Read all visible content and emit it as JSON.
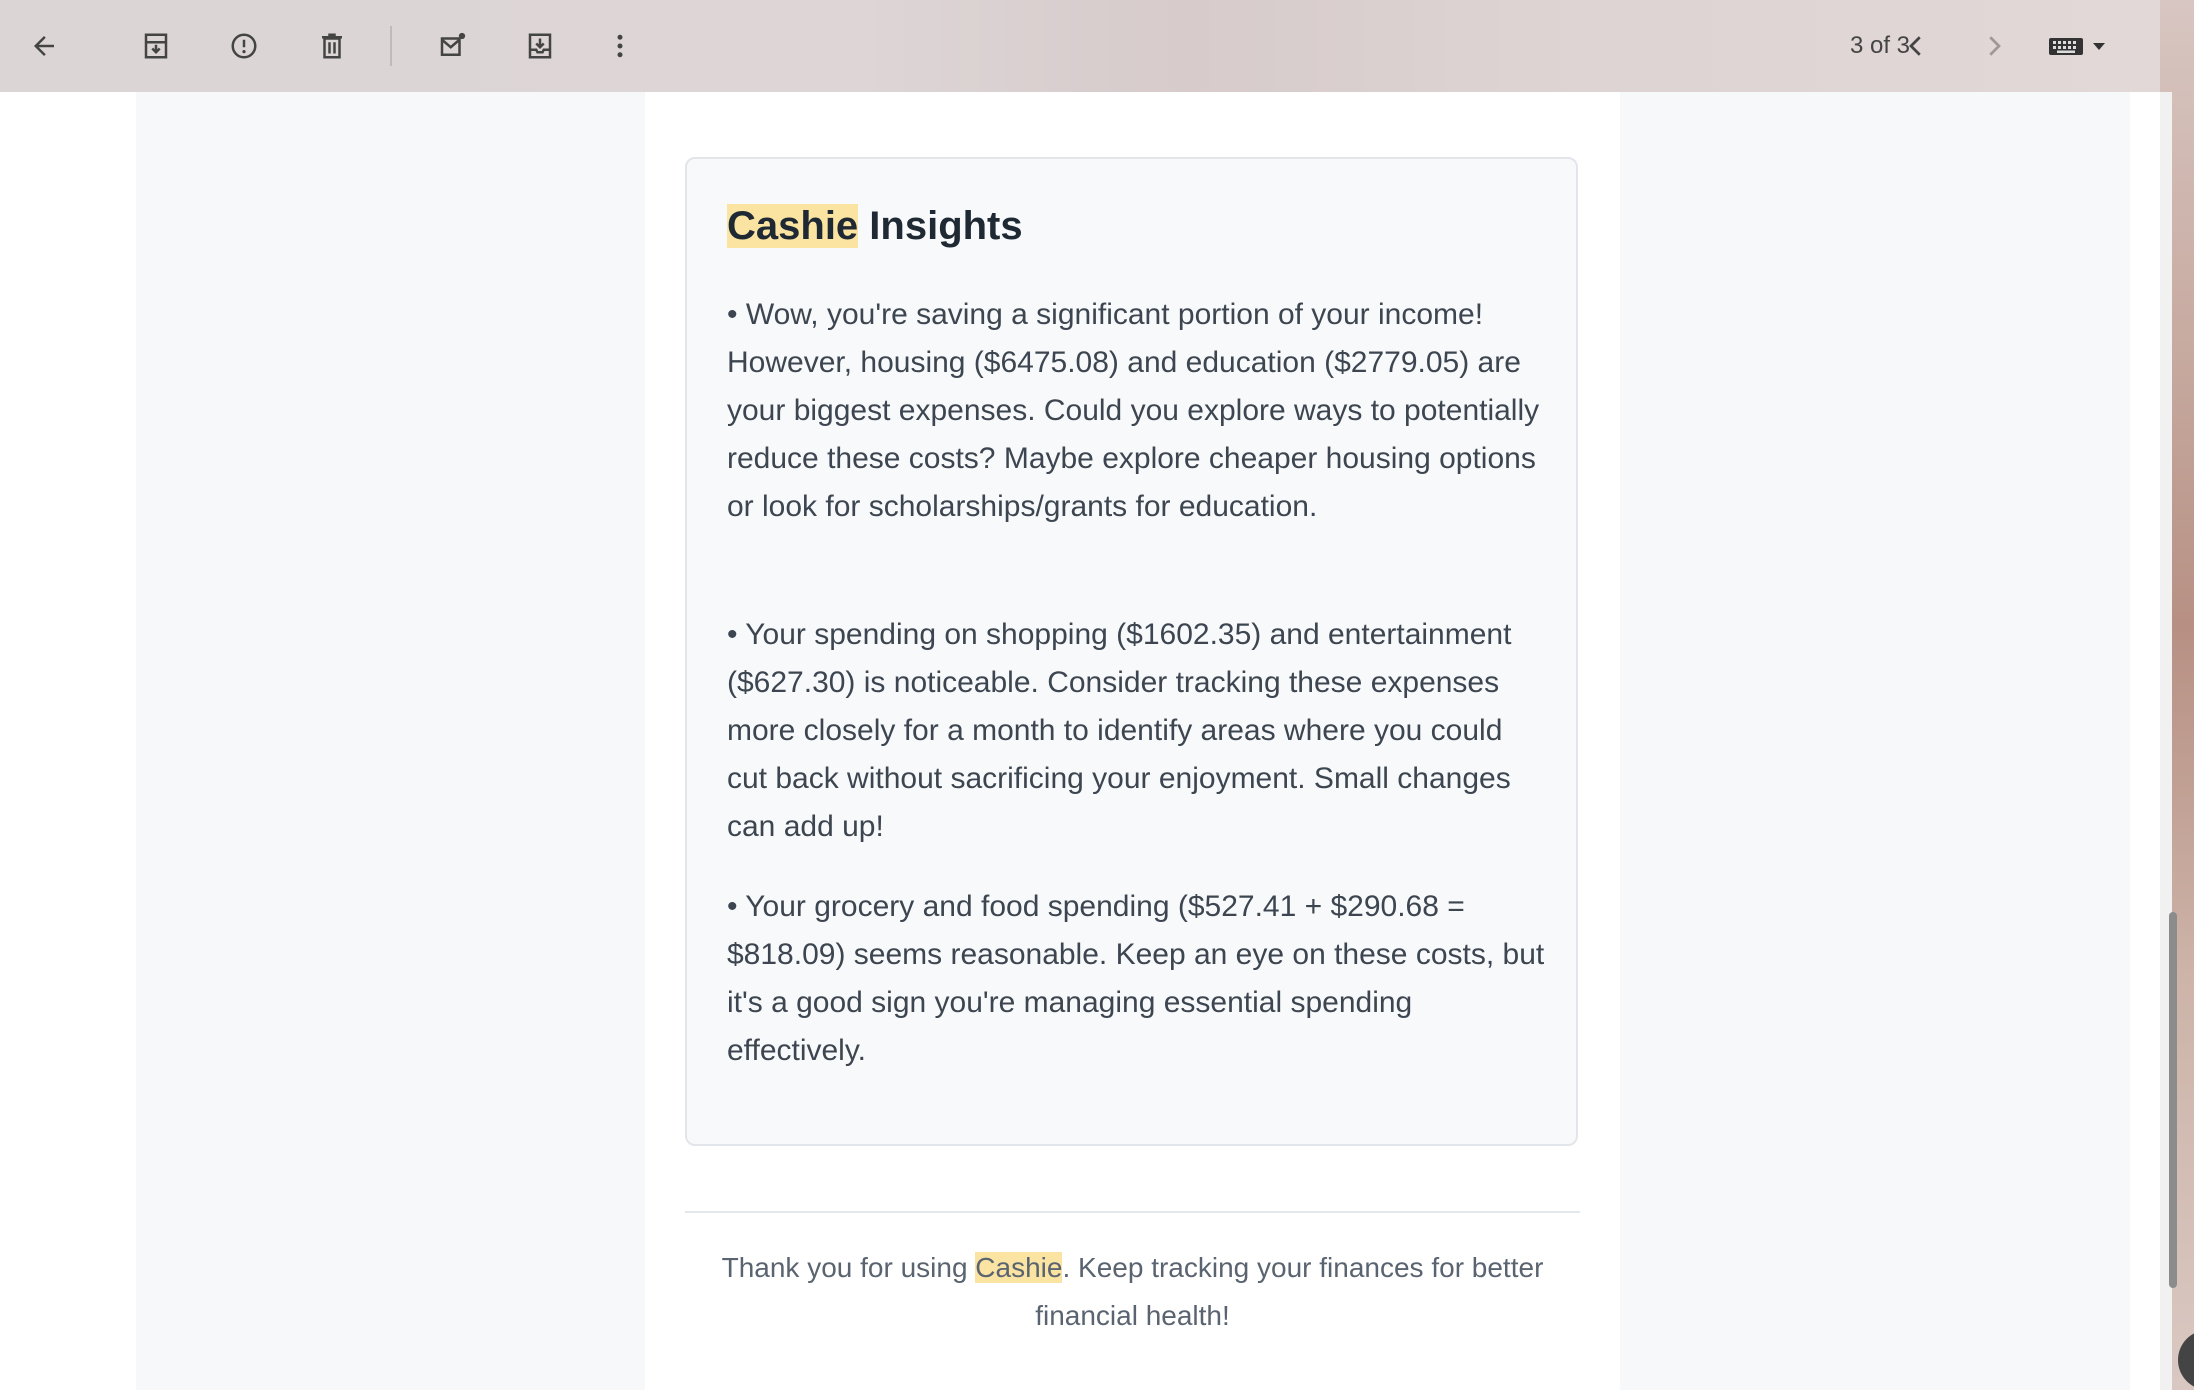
{
  "toolbar": {
    "back_icon": "arrow-left-icon",
    "archive_icon": "archive-icon",
    "report_spam_icon": "report-icon",
    "delete_icon": "trash-icon",
    "mark_unread_icon": "mail-unread-icon",
    "move_to_icon": "move-to-inbox-icon",
    "more_icon": "more-vert-icon",
    "pager_text": "3 of 3",
    "prev_icon": "chevron-left-icon",
    "next_icon": "chevron-right-icon",
    "keyboard_icon": "keyboard-icon"
  },
  "card": {
    "title_highlight": "Cashie",
    "title_rest": " Insights",
    "insights": [
      "• Wow, you're saving a significant portion of your income! However, housing ($6475.08) and education ($2779.05) are your biggest expenses. Could you explore ways to potentially reduce these costs? Maybe explore cheaper housing options or look for scholarships/grants for education.",
      "• Your spending on shopping ($1602.35) and entertainment ($627.30) is noticeable. Consider tracking these expenses more closely for a month to identify areas where you could cut back without sacrificing your enjoyment. Small changes can add up!",
      "• Your grocery and food spending ($527.41 + $290.68 = $818.09) seems reasonable. Keep an eye on these costs, but it's a good sign you're managing essential spending effectively."
    ]
  },
  "footer": {
    "prefix": "Thank you for using ",
    "highlight": "Cashie",
    "suffix": ". Keep tracking your finances for better financial health!"
  },
  "colors": {
    "highlight": "#fbe3a2",
    "heading": "#1f2933",
    "body_text": "#3d4650"
  }
}
